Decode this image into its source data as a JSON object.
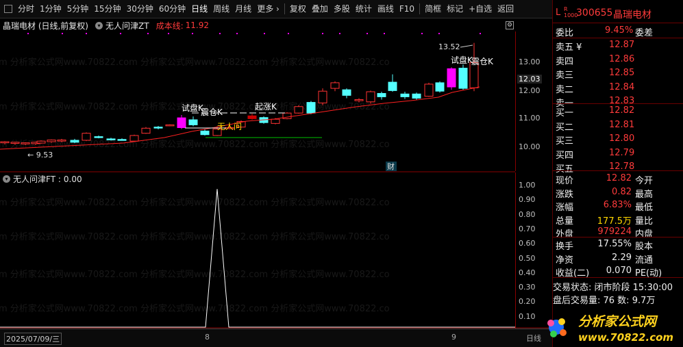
{
  "toolbar": {
    "items": [
      "分时",
      "1分钟",
      "5分钟",
      "15分钟",
      "30分钟",
      "60分钟",
      "日线",
      "周线",
      "月线",
      "更多 ›",
      "复权",
      "叠加",
      "多股",
      "统计",
      "画线",
      "F10",
      "简框",
      "标记",
      "+自选",
      "返回"
    ],
    "active": "日线"
  },
  "main_header": {
    "stock_title": "晶瑞电材 (日线,前复权)",
    "indicator_name": "无人问津ZT",
    "cost_label": "成本线:",
    "cost_value": "11.92"
  },
  "sub_header": {
    "indicator": "无人问津FT :",
    "value": "0.00"
  },
  "annotations": {
    "high_label": "13.52",
    "low_label": "← 9.53",
    "trial_k_1": "试盘K",
    "wash_k_1": "震仓K",
    "rise_k": "起涨K",
    "wuren": "无人问",
    "trial_k_2": "试盘K",
    "wash_k_2": "震仓K",
    "cai": "财"
  },
  "bottom": {
    "date": "2025/07/09/三",
    "month_8": "8",
    "month_9": "9",
    "right_text": "日线"
  },
  "price_axis": {
    "ticks": [
      "13.00",
      "12.00",
      "11.00",
      "10.00"
    ],
    "current": "12.03"
  },
  "sub_axis": {
    "ticks": [
      "1.00",
      "0.90",
      "0.80",
      "0.70",
      "0.60",
      "0.50",
      "0.40",
      "0.30",
      "0.20",
      "0.10"
    ]
  },
  "panel": {
    "code": "300655",
    "name": "晶瑞电材",
    "weibi_label": "委比",
    "weibi_value": "9.45%",
    "weicha_label": "委差",
    "asks": [
      {
        "label": "卖五 ¥",
        "price": "12.87"
      },
      {
        "label": "卖四",
        "price": "12.86"
      },
      {
        "label": "卖三",
        "price": "12.85"
      },
      {
        "label": "卖二",
        "price": "12.84"
      },
      {
        "label": "卖一",
        "price": "12.83"
      }
    ],
    "bids": [
      {
        "label": "买一",
        "price": "12.82"
      },
      {
        "label": "买二",
        "price": "12.81"
      },
      {
        "label": "买三",
        "price": "12.80"
      },
      {
        "label": "买四",
        "price": "12.79"
      },
      {
        "label": "买五",
        "price": "12.78"
      }
    ],
    "stats": [
      {
        "l": "现价",
        "v": "12.82",
        "r": "今开",
        "c": "red"
      },
      {
        "l": "涨跌",
        "v": "0.82",
        "r": "最高",
        "c": "red"
      },
      {
        "l": "涨幅",
        "v": "6.83%",
        "r": "最低",
        "c": "red"
      },
      {
        "l": "总量",
        "v": "177.5万",
        "r": "量比",
        "c": "yellow"
      },
      {
        "l": "外盘",
        "v": "979224",
        "r": "内盘",
        "c": "red"
      }
    ],
    "stats2": [
      {
        "l": "换手",
        "v": "17.55%",
        "r": "股本"
      },
      {
        "l": "净资",
        "v": "2.29",
        "r": "流通"
      },
      {
        "l": "收益(二)",
        "v": "0.070",
        "r": "PE(动)"
      }
    ],
    "trade_status": "交易状态: 闭市阶段 15:30:00",
    "after_trade": "盘后交易量: 76   数: 9.7万"
  },
  "logo": {
    "line1": "分析家公式网",
    "line2": "www.70822.com"
  },
  "watermark": "om 分析家公式网www.70822.com 分析家公式网www.70822.com 分析家公式网www.70822.co",
  "colors": {
    "up": "#ff3232",
    "down": "#54ffff",
    "ma": "#ff2020",
    "magenta": "#ff00ff",
    "green": "#00c000"
  }
}
